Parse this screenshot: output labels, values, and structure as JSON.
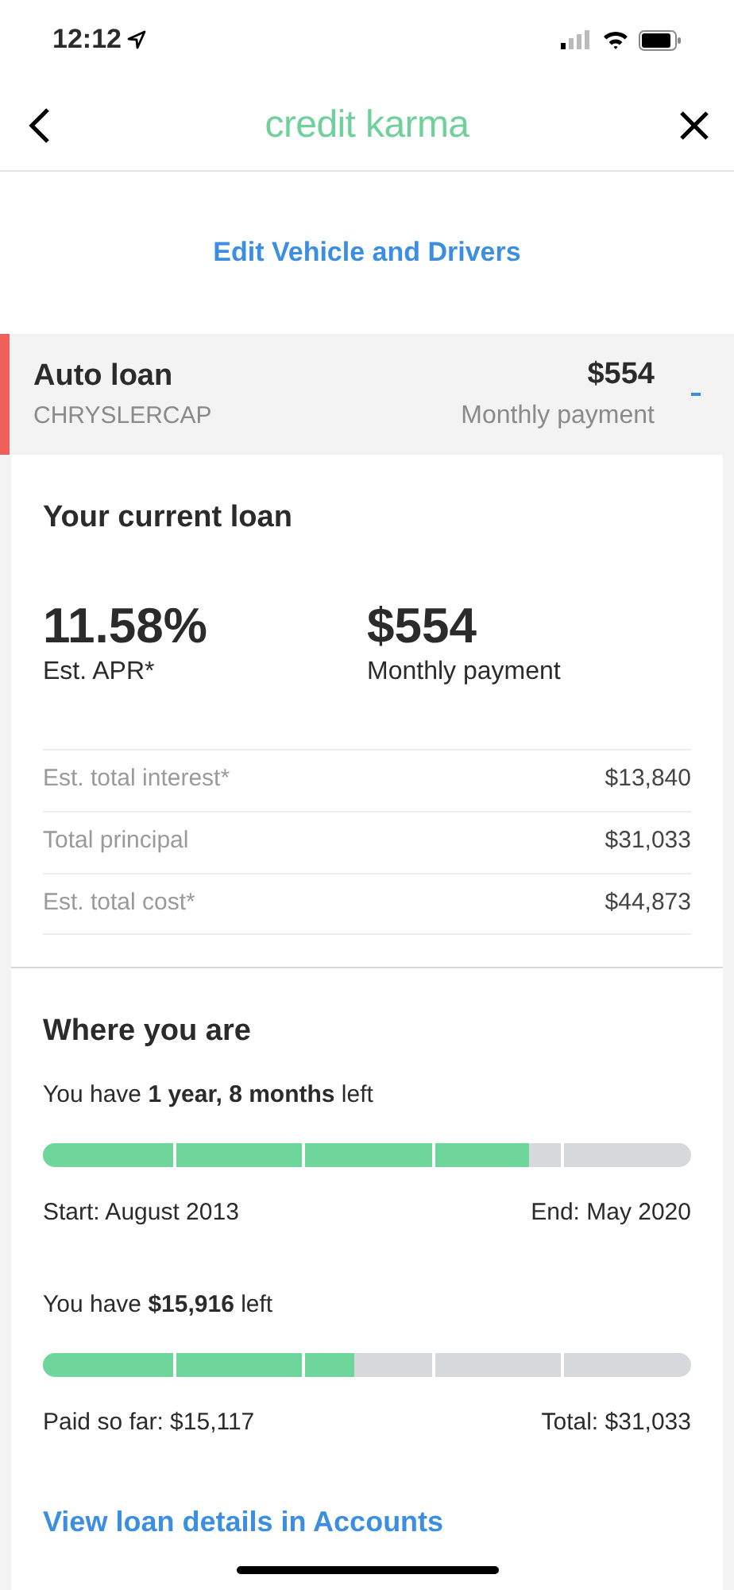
{
  "status_bar": {
    "time": "12:12"
  },
  "nav": {
    "logo": "credit karma"
  },
  "edit_link": "Edit Vehicle and Drivers",
  "loan_header": {
    "title": "Auto loan",
    "lender": "CHRYSLERCAP",
    "amount": "$554",
    "amount_label": "Monthly payment",
    "expanded": true,
    "color": "#ef5f5b"
  },
  "current_loan": {
    "title": "Your current loan",
    "stats": [
      {
        "value": "11.58%",
        "label": "Est. APR*"
      },
      {
        "value": "$554",
        "label": "Monthly payment"
      }
    ],
    "rows": [
      {
        "label": "Est. total interest*",
        "value": "$13,840"
      },
      {
        "label": "Total principal",
        "value": "$31,033"
      },
      {
        "label": "Est. total cost*",
        "value": "$44,873"
      }
    ]
  },
  "where_you_are": {
    "title": "Where you are",
    "progress": [
      {
        "summary": "You have **1 year, 8 months** left",
        "level": 0.75,
        "left_label": "Start: August 2013",
        "right_label": "End: May 2020"
      },
      {
        "summary": "You have **$15,916** left",
        "level": 0.48,
        "left_label": "Paid so far: $15,117",
        "right_label": "Total: $31,033"
      }
    ],
    "link": "View loan details in Accounts"
  }
}
